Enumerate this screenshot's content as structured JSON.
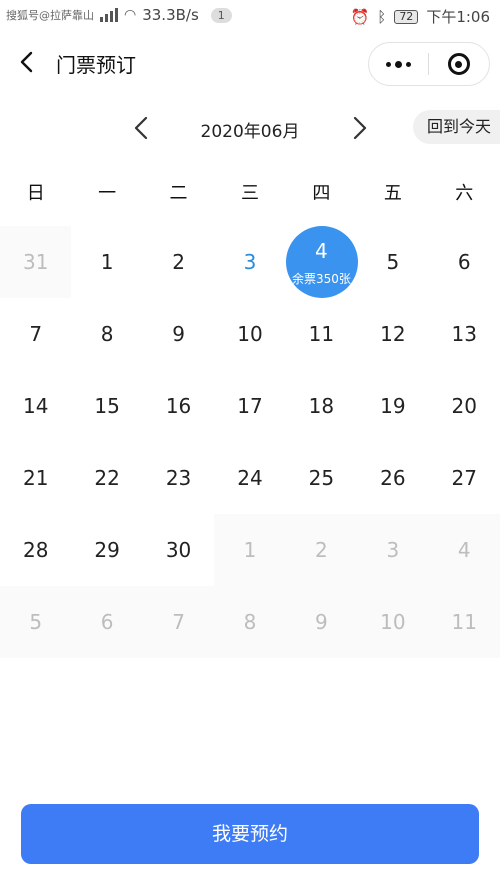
{
  "status_bar": {
    "carrier": "搜狐号@拉萨靠山",
    "speed": "33.3B/s",
    "notification_count": "1",
    "battery": "72",
    "time": "下午1:06"
  },
  "nav": {
    "title": "门票预订",
    "icons": {
      "back": "chevron-left-icon",
      "more": "more-dots-icon",
      "close": "target-close-icon"
    }
  },
  "calendar": {
    "month_label": "2020年06月",
    "today_button": "回到今天",
    "weekdays": [
      "日",
      "一",
      "二",
      "三",
      "四",
      "五",
      "六"
    ],
    "weeks": [
      [
        {
          "d": "31",
          "state": "out"
        },
        {
          "d": "1"
        },
        {
          "d": "2"
        },
        {
          "d": "3",
          "state": "today"
        },
        {
          "d": "4",
          "state": "selected",
          "sub": "余票350张"
        },
        {
          "d": "5"
        },
        {
          "d": "6"
        }
      ],
      [
        {
          "d": "7"
        },
        {
          "d": "8"
        },
        {
          "d": "9"
        },
        {
          "d": "10"
        },
        {
          "d": "11"
        },
        {
          "d": "12"
        },
        {
          "d": "13"
        }
      ],
      [
        {
          "d": "14"
        },
        {
          "d": "15"
        },
        {
          "d": "16"
        },
        {
          "d": "17"
        },
        {
          "d": "18"
        },
        {
          "d": "19"
        },
        {
          "d": "20"
        }
      ],
      [
        {
          "d": "21"
        },
        {
          "d": "22"
        },
        {
          "d": "23"
        },
        {
          "d": "24"
        },
        {
          "d": "25"
        },
        {
          "d": "26"
        },
        {
          "d": "27"
        }
      ],
      [
        {
          "d": "28"
        },
        {
          "d": "29"
        },
        {
          "d": "30"
        },
        {
          "d": "1",
          "state": "out"
        },
        {
          "d": "2",
          "state": "out"
        },
        {
          "d": "3",
          "state": "out"
        },
        {
          "d": "4",
          "state": "out"
        }
      ],
      [
        {
          "d": "5",
          "state": "out"
        },
        {
          "d": "6",
          "state": "out"
        },
        {
          "d": "7",
          "state": "out"
        },
        {
          "d": "8",
          "state": "out"
        },
        {
          "d": "9",
          "state": "out"
        },
        {
          "d": "10",
          "state": "out"
        },
        {
          "d": "11",
          "state": "out"
        }
      ]
    ],
    "colors": {
      "today": "#2a8bd8",
      "selected_bg": "#3a93ee",
      "out_text": "#bdbdbd"
    }
  },
  "footer": {
    "book_button": "我要预约",
    "button_color": "#3d7cf5"
  }
}
